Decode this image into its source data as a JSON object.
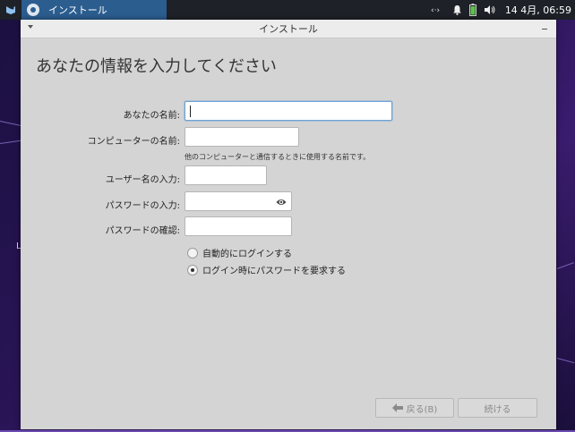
{
  "panel": {
    "task_title": "インストール",
    "clock": "14 4月, 06:59",
    "icons": [
      "app-menu-icon",
      "network-icon",
      "notification-bell-icon",
      "battery-icon",
      "volume-icon"
    ]
  },
  "window": {
    "title": "インストール",
    "heading": "あなたの情報を入力してください"
  },
  "form": {
    "name_label": "あなたの名前:",
    "name_value": "",
    "computer_label": "コンピューターの名前:",
    "computer_value": "",
    "computer_hint": "他のコンピューターと通信するときに使用する名前です。",
    "username_label": "ユーザー名の入力:",
    "username_value": "",
    "password_label": "パスワードの入力:",
    "password_value": "",
    "confirm_label": "パスワードの確認:",
    "confirm_value": "",
    "auto_login_label": "自動的にログインする",
    "require_password_label": "ログイン時にパスワードを要求する",
    "selected_option": "require_password"
  },
  "buttons": {
    "back_label": "戻る(B)",
    "continue_label": "続ける"
  },
  "colors": {
    "panel_bg": "#1e2127",
    "task_active": "#2b5d8f",
    "window_bg": "#d4d4d4",
    "focus_border": "#6fa3d5"
  }
}
